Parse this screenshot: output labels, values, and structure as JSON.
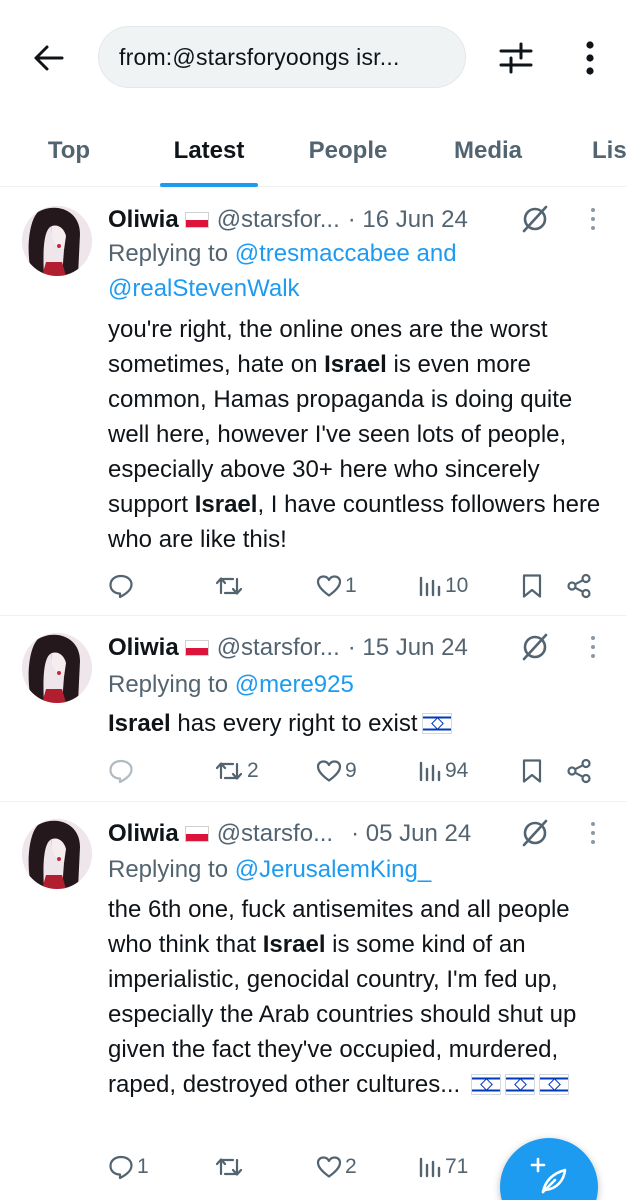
{
  "search": {
    "query": "from:@starsforyoongs isr..."
  },
  "tabs": [
    {
      "label": "Top"
    },
    {
      "label": "Latest"
    },
    {
      "label": "People"
    },
    {
      "label": "Media"
    },
    {
      "label": "Lis"
    }
  ],
  "active_tab": "Latest",
  "colors": {
    "accent": "#1d9bf0",
    "text": "#0f1419",
    "secondary": "#536471"
  },
  "tweets": [
    {
      "name": "Oliwia",
      "flag": "poland-flag",
      "handle": "@starsfor...",
      "date": "· 16 Jun 24",
      "reply_prefix": "Replying to",
      "reply_to": "@tresmaccabee and @realStevenWalk",
      "text": [
        {
          "t": "you're right, the online ones are the worst sometimes, hate on "
        },
        {
          "b": "Israel"
        },
        {
          "t": " is even more common, Hamas propaganda is doing quite well here, however I've seen lots of people, especially above 30+ here who sincerely support "
        },
        {
          "b": "Israel"
        },
        {
          "t": ", I have countless followers here who are like this!"
        }
      ],
      "flags_after": 0,
      "replies": "",
      "retweets": "",
      "likes": "1",
      "views": "10"
    },
    {
      "name": "Oliwia",
      "flag": "poland-flag",
      "handle": "@starsfor...",
      "date": "· 15 Jun 24",
      "reply_prefix": "Replying to",
      "reply_to": "@mere925",
      "text": [
        {
          "b": "Israel"
        },
        {
          "t": " has every right to exist"
        }
      ],
      "flags_after": 1,
      "replies": "",
      "retweets": "2",
      "likes": "9",
      "views": "94"
    },
    {
      "name": "Oliwia",
      "flag": "poland-flag",
      "handle": "@starsfo...",
      "date": "· 05 Jun 24",
      "reply_prefix": "Replying to",
      "reply_to": "@JerusalemKing_",
      "text": [
        {
          "t": "the 6th one, fuck antisemites and all people who think that "
        },
        {
          "b": "Israel"
        },
        {
          "t": " is some kind of an imperialistic, genocidal country, I'm fed up, especially the Arab countries should shut up given the fact they've occupied, murdered, raped, destroyed other cultures... "
        }
      ],
      "flags_after": 3,
      "replies": "1",
      "retweets": "",
      "likes": "2",
      "views": "71"
    }
  ]
}
